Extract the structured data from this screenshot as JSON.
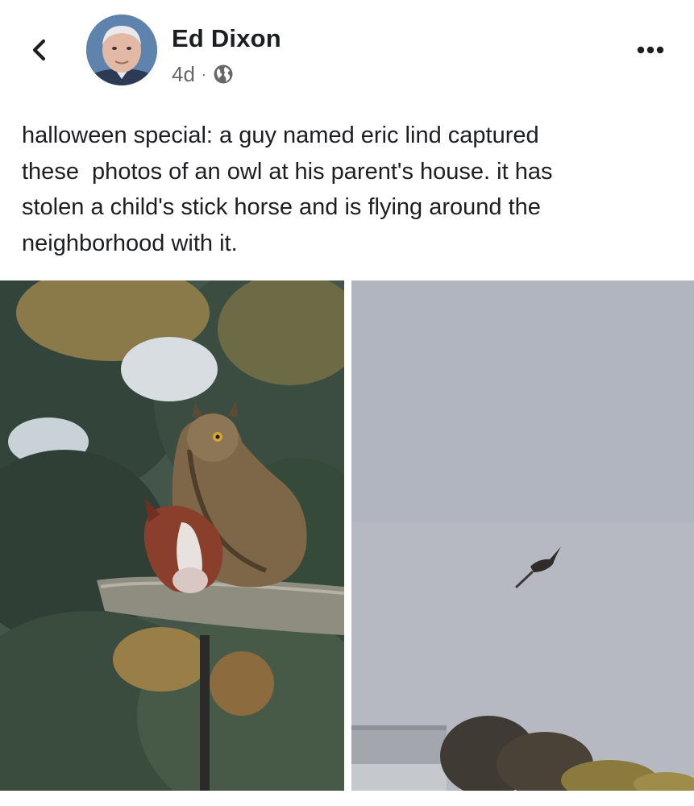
{
  "post": {
    "author": "Ed Dixon",
    "timestamp": "4d",
    "separator": "·",
    "privacy_icon": "globe-icon",
    "text": "halloween special: a guy named eric lind captured\nthese  photos of an owl at his parent's house. it has\nstolen a child's stick horse and is flying around the\nneighborhood with it."
  },
  "header": {
    "back_icon": "chevron-left-icon",
    "more_icon": "more-horizontal-icon"
  },
  "photos": [
    {
      "subject": "owl perched with stick horse"
    },
    {
      "subject": "owl flying with stick horse"
    }
  ],
  "colors": {
    "text_primary": "#1c1e21",
    "text_secondary": "#65676b",
    "background": "#ffffff"
  }
}
